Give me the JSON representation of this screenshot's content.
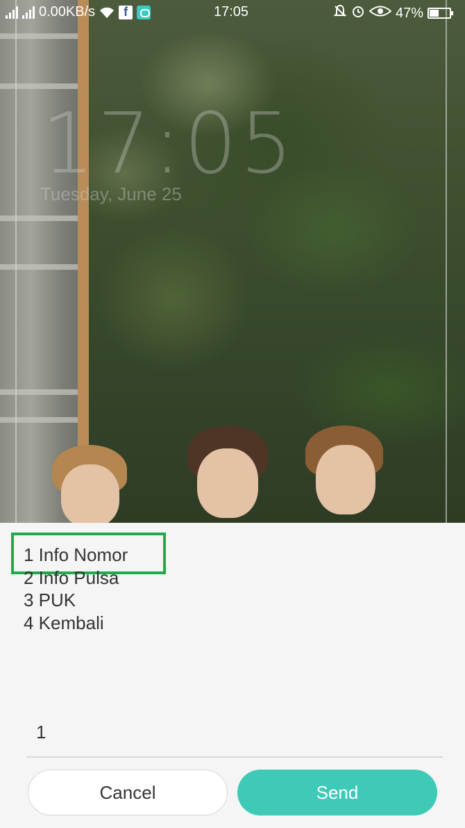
{
  "status_bar": {
    "network_speed": "0.00KB/s",
    "time": "17:05",
    "battery_percent": "47%",
    "battery_level": 0.47,
    "icons": [
      "signal-icon",
      "wifi-icon",
      "facebook-icon",
      "chat-app-icon",
      "alarm-off-icon",
      "alarm-icon",
      "eye-icon",
      "battery-icon"
    ]
  },
  "lock_screen": {
    "clock": "17:05",
    "date": "Tuesday, June 25"
  },
  "ussd_dialog": {
    "menu_items": [
      "1 Info Nomor",
      "2 Info Pulsa",
      "3 PUK",
      "4 Kembali"
    ],
    "input_value": "1",
    "cancel_label": "Cancel",
    "send_label": "Send",
    "colors": {
      "send_button": "#3fcab8",
      "highlight": "#1fa94b"
    }
  }
}
